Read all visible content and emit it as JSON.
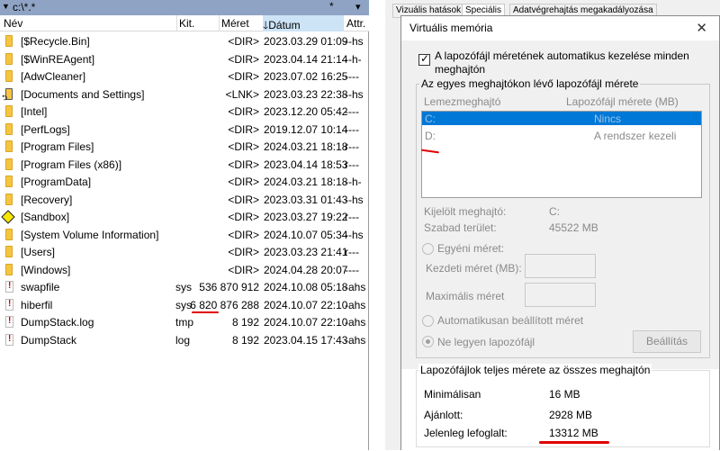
{
  "fm": {
    "path": "c:\\*.*",
    "star": "*",
    "columns": {
      "name": "Név",
      "ext": "Kit.",
      "size": "Méret",
      "date": "Dátum",
      "attr": "Attr."
    },
    "rows": [
      {
        "icon": "folder-icon",
        "name": "[$Recycle.Bin]",
        "ext": "",
        "size": "<DIR>",
        "date": "2023.03.29 01:09",
        "attr": "--hs"
      },
      {
        "icon": "folder-icon",
        "name": "[$WinREAgent]",
        "ext": "",
        "size": "<DIR>",
        "date": "2023.04.14 21:14",
        "attr": "--h-"
      },
      {
        "icon": "folder-icon",
        "name": "[AdwCleaner]",
        "ext": "",
        "size": "<DIR>",
        "date": "2023.07.02 16:25",
        "attr": "----"
      },
      {
        "icon": "link-folder-icon",
        "name": "[Documents and Settings]",
        "ext": "",
        "size": "<LNK>",
        "date": "2023.03.23 22:38",
        "attr": "--hs"
      },
      {
        "icon": "folder-icon",
        "name": "[Intel]",
        "ext": "",
        "size": "<DIR>",
        "date": "2023.12.20 05:42",
        "attr": "----"
      },
      {
        "icon": "folder-icon",
        "name": "[PerfLogs]",
        "ext": "",
        "size": "<DIR>",
        "date": "2019.12.07 10:14",
        "attr": "----"
      },
      {
        "icon": "folder-icon",
        "name": "[Program Files]",
        "ext": "",
        "size": "<DIR>",
        "date": "2024.03.21 18:18",
        "attr": "r---"
      },
      {
        "icon": "folder-icon",
        "name": "[Program Files (x86)]",
        "ext": "",
        "size": "<DIR>",
        "date": "2023.04.14 18:53",
        "attr": "r---"
      },
      {
        "icon": "folder-icon",
        "name": "[ProgramData]",
        "ext": "",
        "size": "<DIR>",
        "date": "2024.03.21 18:18",
        "attr": "--h-"
      },
      {
        "icon": "folder-icon",
        "name": "[Recovery]",
        "ext": "",
        "size": "<DIR>",
        "date": "2023.03.31 01:43",
        "attr": "--hs"
      },
      {
        "icon": "sandbox-diamond-icon",
        "name": "[Sandbox]",
        "ext": "",
        "size": "<DIR>",
        "date": "2023.03.27 19:22",
        "attr": "r---"
      },
      {
        "icon": "folder-icon",
        "name": "[System Volume Information]",
        "ext": "",
        "size": "<DIR>",
        "date": "2024.10.07 05:34",
        "attr": "--hs"
      },
      {
        "icon": "folder-icon",
        "name": "[Users]",
        "ext": "",
        "size": "<DIR>",
        "date": "2023.03.23 21:41",
        "attr": "r---"
      },
      {
        "icon": "folder-icon",
        "name": "[Windows]",
        "ext": "",
        "size": "<DIR>",
        "date": "2024.04.28 20:07",
        "attr": "----"
      },
      {
        "icon": "system-file-icon",
        "name": "swapfile",
        "ext": "sys",
        "size": "536 870 912",
        "date": "2024.10.08 05:18",
        "attr": "-ahs"
      },
      {
        "icon": "system-file-icon",
        "name": "hiberfil",
        "ext": "sys",
        "size": "6 820 876 288",
        "date": "2024.10.07 22:10",
        "attr": "-ahs"
      },
      {
        "icon": "system-file-icon",
        "name": "DumpStack.log",
        "ext": "tmp",
        "size": "8 192",
        "date": "2024.10.07 22:10",
        "attr": "-ahs"
      },
      {
        "icon": "system-file-icon",
        "name": "DumpStack",
        "ext": "log",
        "size": "8 192",
        "date": "2023.04.15 17:43",
        "attr": "-ahs"
      }
    ]
  },
  "tabs": [
    "Vizuális hatások",
    "Speciális",
    "Adatvégrehajtás megakadályozása"
  ],
  "dialog": {
    "title": "Virtuális memória",
    "auto_manage": "A lapozófájl méretének automatikus kezelése minden meghajtón",
    "per_drive_group": "Az egyes meghajtókon lévő lapozófájl mérete",
    "list_headers": {
      "drive": "Lemezmeghajtó",
      "size": "Lapozófájl mérete (MB)"
    },
    "drives": [
      {
        "drive": "C:",
        "size": "Nincs"
      },
      {
        "drive": "D:",
        "size": "A rendszer kezeli"
      }
    ],
    "selected_drive_label": "Kijelölt meghajtó:",
    "selected_drive_value": "C:",
    "free_space_label": "Szabad terület:",
    "free_space_value": "45522  MB",
    "custom_size": "Egyéni méret:",
    "initial_size": "Kezdeti méret (MB):",
    "max_size": "Maximális méret",
    "system_managed": "Automatikusan beállított méret",
    "no_paging": "Ne legyen lapozófájl",
    "set_button": "Beállítás",
    "total_group": "Lapozófájlok teljes mérete az összes meghajtón",
    "minimum_label": "Minimálisan",
    "minimum_value": "16  MB",
    "recommended_label": "Ajánlott:",
    "recommended_value": "2928  MB",
    "current_label": "Jelenleg lefoglalt:",
    "current_value": "13312  MB"
  },
  "colors": {
    "accent": "#0078d7",
    "pathbar": "#8fa3c4",
    "sort_header": "#cde4f7",
    "highlight": "#e00000"
  }
}
